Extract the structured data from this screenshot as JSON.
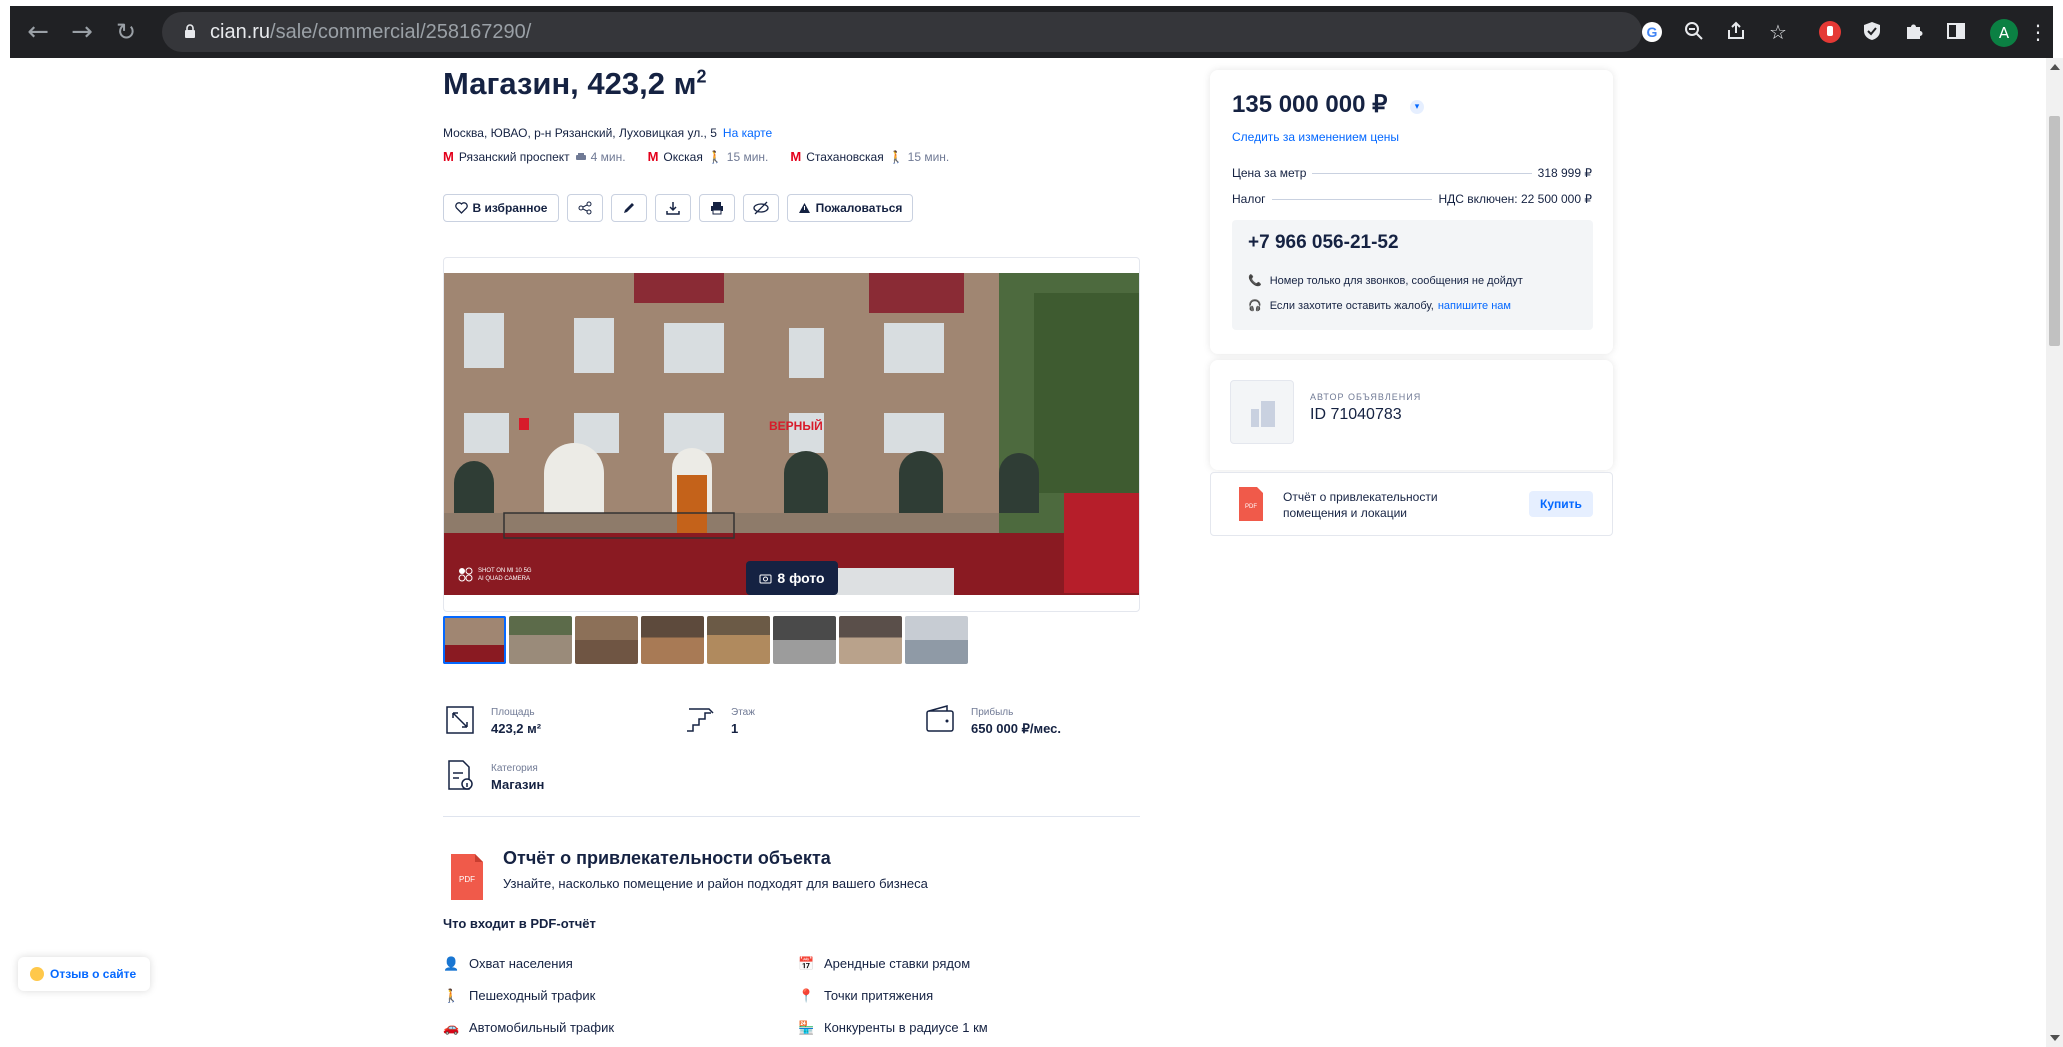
{
  "browser": {
    "url_domain": "cian.ru",
    "url_path": "/sale/commercial/258167290/",
    "profile_initial": "A"
  },
  "listing": {
    "title": "Магазин, 423,2 м",
    "title_sup": "2",
    "address": "Москва, ЮВАО, р-н Рязанский, Луховицкая ул., 5",
    "map_link": "На карте",
    "metro": [
      {
        "station": "Рязанский проспект",
        "time": "4 мин."
      },
      {
        "station": "Окская",
        "time": "15 мин."
      },
      {
        "station": "Стахановская",
        "time": "15 мин."
      }
    ],
    "actions": {
      "favorite": "В избранное",
      "complain": "Пожаловаться"
    },
    "photo_count": "8 фото",
    "photo_watermark": "SHOT ON MI 10 5G\nAI QUAD CAMERA"
  },
  "facts": [
    {
      "label": "Площадь",
      "value": "423,2 м²"
    },
    {
      "label": "Этаж",
      "value": "1"
    },
    {
      "label": "Прибыль",
      "value": "650 000 ₽/мес."
    },
    {
      "label": "Категория",
      "value": "Магазин"
    }
  ],
  "report": {
    "title": "Отчёт о привлекательности объекта",
    "subtitle": "Узнайте, насколько помещение и район подходят для вашего бизнеса",
    "includes_title": "Что входит в PDF-отчёт",
    "features": [
      "Охват населения",
      "Арендные ставки рядом",
      "Пешеходный трафик",
      "Точки притяжения",
      "Автомобильный трафик",
      "Конкуренты в радиусе 1 км"
    ]
  },
  "price_card": {
    "price": "135 000 000 ₽",
    "track_link": "Следить за изменением цены",
    "price_per_meter_label": "Цена за метр",
    "price_per_meter_value": "318 999 ₽",
    "tax_label": "Налог",
    "tax_value": "НДС включен: 22 500 000 ₽",
    "phone": "+7 966 056-21-52",
    "phone_note_1": "Номер только для звонков, сообщения не дойдут",
    "phone_note_2": "Если захотите оставить жалобу,",
    "phone_note_2_link": "напишите нам"
  },
  "author": {
    "label": "АВТОР ОБЪЯВЛЕНИЯ",
    "id": "ID 71040783"
  },
  "buy_report": {
    "text": "Отчёт о привлекательности помещения и локации",
    "button": "Купить",
    "pdf_label": "PDF"
  },
  "feedback": {
    "label": "Отзыв о сайте"
  },
  "colors": {
    "primary_text": "#152242",
    "link": "#0468ff",
    "metro": "#e3001b",
    "pdf_red": "#f05a4a"
  }
}
